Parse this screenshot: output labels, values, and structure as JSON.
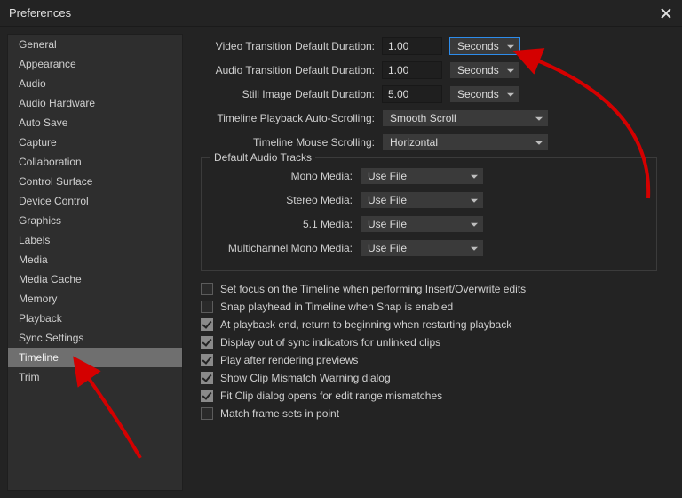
{
  "window": {
    "title": "Preferences"
  },
  "sidebar": {
    "items": [
      {
        "label": "General"
      },
      {
        "label": "Appearance"
      },
      {
        "label": "Audio"
      },
      {
        "label": "Audio Hardware"
      },
      {
        "label": "Auto Save"
      },
      {
        "label": "Capture"
      },
      {
        "label": "Collaboration"
      },
      {
        "label": "Control Surface"
      },
      {
        "label": "Device Control"
      },
      {
        "label": "Graphics"
      },
      {
        "label": "Labels"
      },
      {
        "label": "Media"
      },
      {
        "label": "Media Cache"
      },
      {
        "label": "Memory"
      },
      {
        "label": "Playback"
      },
      {
        "label": "Sync Settings"
      },
      {
        "label": "Timeline"
      },
      {
        "label": "Trim"
      }
    ],
    "selected_index": 16
  },
  "settings": {
    "videoTransition": {
      "label": "Video Transition Default Duration:",
      "value": "1.00",
      "unit": "Seconds"
    },
    "audioTransition": {
      "label": "Audio Transition Default Duration:",
      "value": "1.00",
      "unit": "Seconds"
    },
    "stillImage": {
      "label": "Still Image Default Duration:",
      "value": "5.00",
      "unit": "Seconds"
    },
    "playbackScroll": {
      "label": "Timeline Playback Auto-Scrolling:",
      "value": "Smooth Scroll"
    },
    "mouseScroll": {
      "label": "Timeline Mouse Scrolling:",
      "value": "Horizontal"
    }
  },
  "audioGroup": {
    "legend": "Default Audio Tracks",
    "mono": {
      "label": "Mono Media:",
      "value": "Use File"
    },
    "stereo": {
      "label": "Stereo Media:",
      "value": "Use File"
    },
    "five1": {
      "label": "5.1 Media:",
      "value": "Use File"
    },
    "multi": {
      "label": "Multichannel Mono Media:",
      "value": "Use File"
    }
  },
  "checks": [
    {
      "checked": false,
      "label": "Set focus on the Timeline when performing Insert/Overwrite edits"
    },
    {
      "checked": false,
      "label": "Snap playhead in Timeline when Snap is enabled"
    },
    {
      "checked": true,
      "label": "At playback end, return to beginning when restarting playback"
    },
    {
      "checked": true,
      "label": "Display out of sync indicators for unlinked clips"
    },
    {
      "checked": true,
      "label": "Play after rendering previews"
    },
    {
      "checked": true,
      "label": "Show Clip Mismatch Warning dialog"
    },
    {
      "checked": true,
      "label": "Fit Clip dialog opens for edit range mismatches"
    },
    {
      "checked": false,
      "label": "Match frame sets in point"
    }
  ],
  "annotations": {
    "arrow1_desc": "red arrow pointing at Seconds unit dropdown",
    "arrow2_desc": "red arrow pointing at Timeline sidebar item"
  }
}
